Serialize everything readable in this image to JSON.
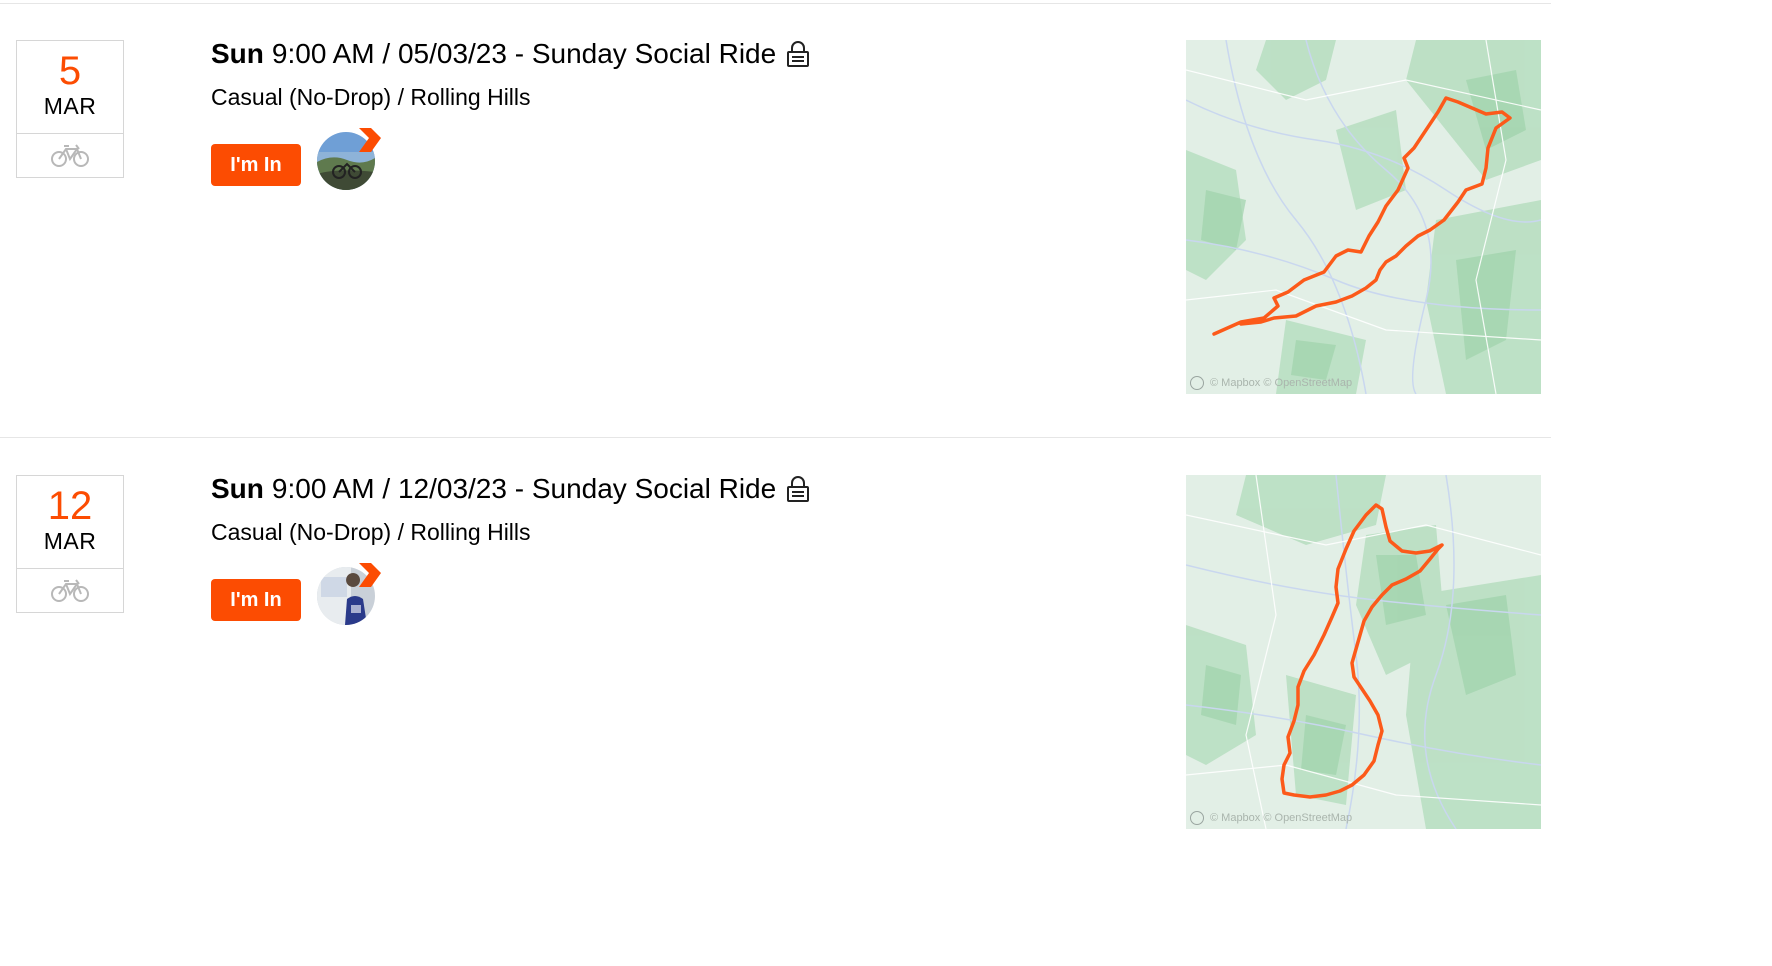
{
  "events": [
    {
      "date": {
        "day": "5",
        "month": "MAR",
        "sport_icon": "bike-icon"
      },
      "title": {
        "weekday": "Sun",
        "rest": "9:00 AM / 05/03/23 - Sunday Social Ride",
        "lock_icon": "lock-icon"
      },
      "subtitle": "Casual (No-Drop) / Rolling Hills",
      "join_label": "I'm In",
      "attendee_avatar": "attendee-avatar",
      "map": {
        "attribution": "© Mapbox © OpenStreetMap"
      }
    },
    {
      "date": {
        "day": "12",
        "month": "MAR",
        "sport_icon": "bike-icon"
      },
      "title": {
        "weekday": "Sun",
        "rest": "9:00 AM / 12/03/23 - Sunday Social Ride",
        "lock_icon": "lock-icon"
      },
      "subtitle": "Casual (No-Drop) / Rolling Hills",
      "join_label": "I'm In",
      "attendee_avatar": "attendee-avatar",
      "map": {
        "attribution": "© Mapbox © OpenStreetMap"
      }
    }
  ],
  "colors": {
    "accent": "#fc4c02",
    "route": "#fc5a1a",
    "map_base": "#dfeee4",
    "divider": "#e6e6e6"
  }
}
